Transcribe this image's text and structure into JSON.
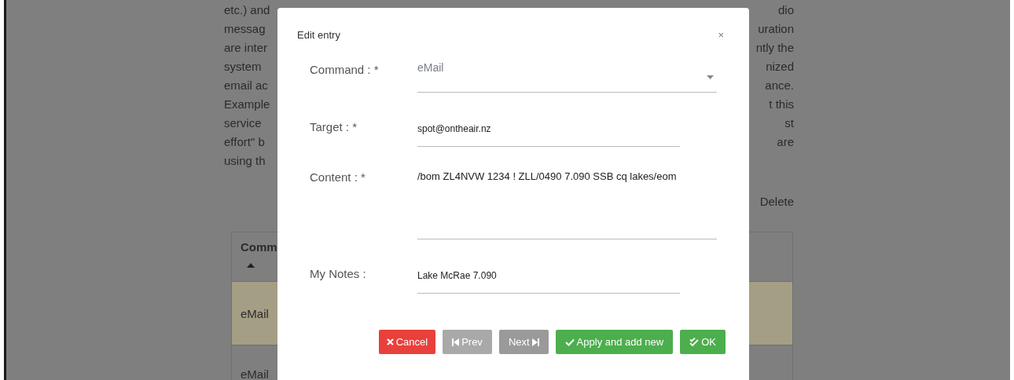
{
  "page": {
    "paragraph_lines": [
      {
        "left": "etc.) and",
        "right": "dio"
      },
      {
        "left": "messag",
        "right": "uration"
      },
      {
        "left": "are inter",
        "right": "ntly the"
      },
      {
        "left": "system",
        "right": "nized"
      },
      {
        "left": "email ac",
        "right": "ance."
      },
      {
        "left": "Example",
        "right": "t this"
      },
      {
        "left": "service",
        "right": "st"
      },
      {
        "left": "effort\" b",
        "right": "are"
      },
      {
        "left": "using th"
      }
    ],
    "delete_link": "Delete",
    "table": {
      "columns": [
        {
          "label": "Comm",
          "sort_ascending": true
        }
      ],
      "rows": [
        {
          "cells": [
            "eMail"
          ],
          "selected": true
        },
        {
          "cells": [
            "eMail"
          ],
          "selected": false
        }
      ]
    }
  },
  "modal": {
    "title": "Edit entry",
    "close": "×",
    "fields": [
      {
        "kind": "select",
        "label": "Command : *",
        "value": "eMail"
      },
      {
        "kind": "input",
        "label": "Target : *",
        "value": "spot@ontheair.nz"
      },
      {
        "kind": "textarea",
        "label": "Content : *",
        "value": "/bom ZL4NVW 1234 ! ZLL/0490 7.090 SSB cq lakes/eom"
      },
      {
        "kind": "input",
        "label": "My Notes :",
        "value": "Lake McRae 7.090"
      }
    ],
    "buttons": [
      {
        "kind": "cancel",
        "label": "Cancel",
        "disabled": false
      },
      {
        "kind": "prev",
        "label": "Prev",
        "disabled": true
      },
      {
        "kind": "next",
        "label": "Next",
        "disabled": false
      },
      {
        "kind": "apply",
        "label": "Apply and add new",
        "disabled": false
      },
      {
        "kind": "ok",
        "label": "OK",
        "disabled": false
      }
    ]
  }
}
